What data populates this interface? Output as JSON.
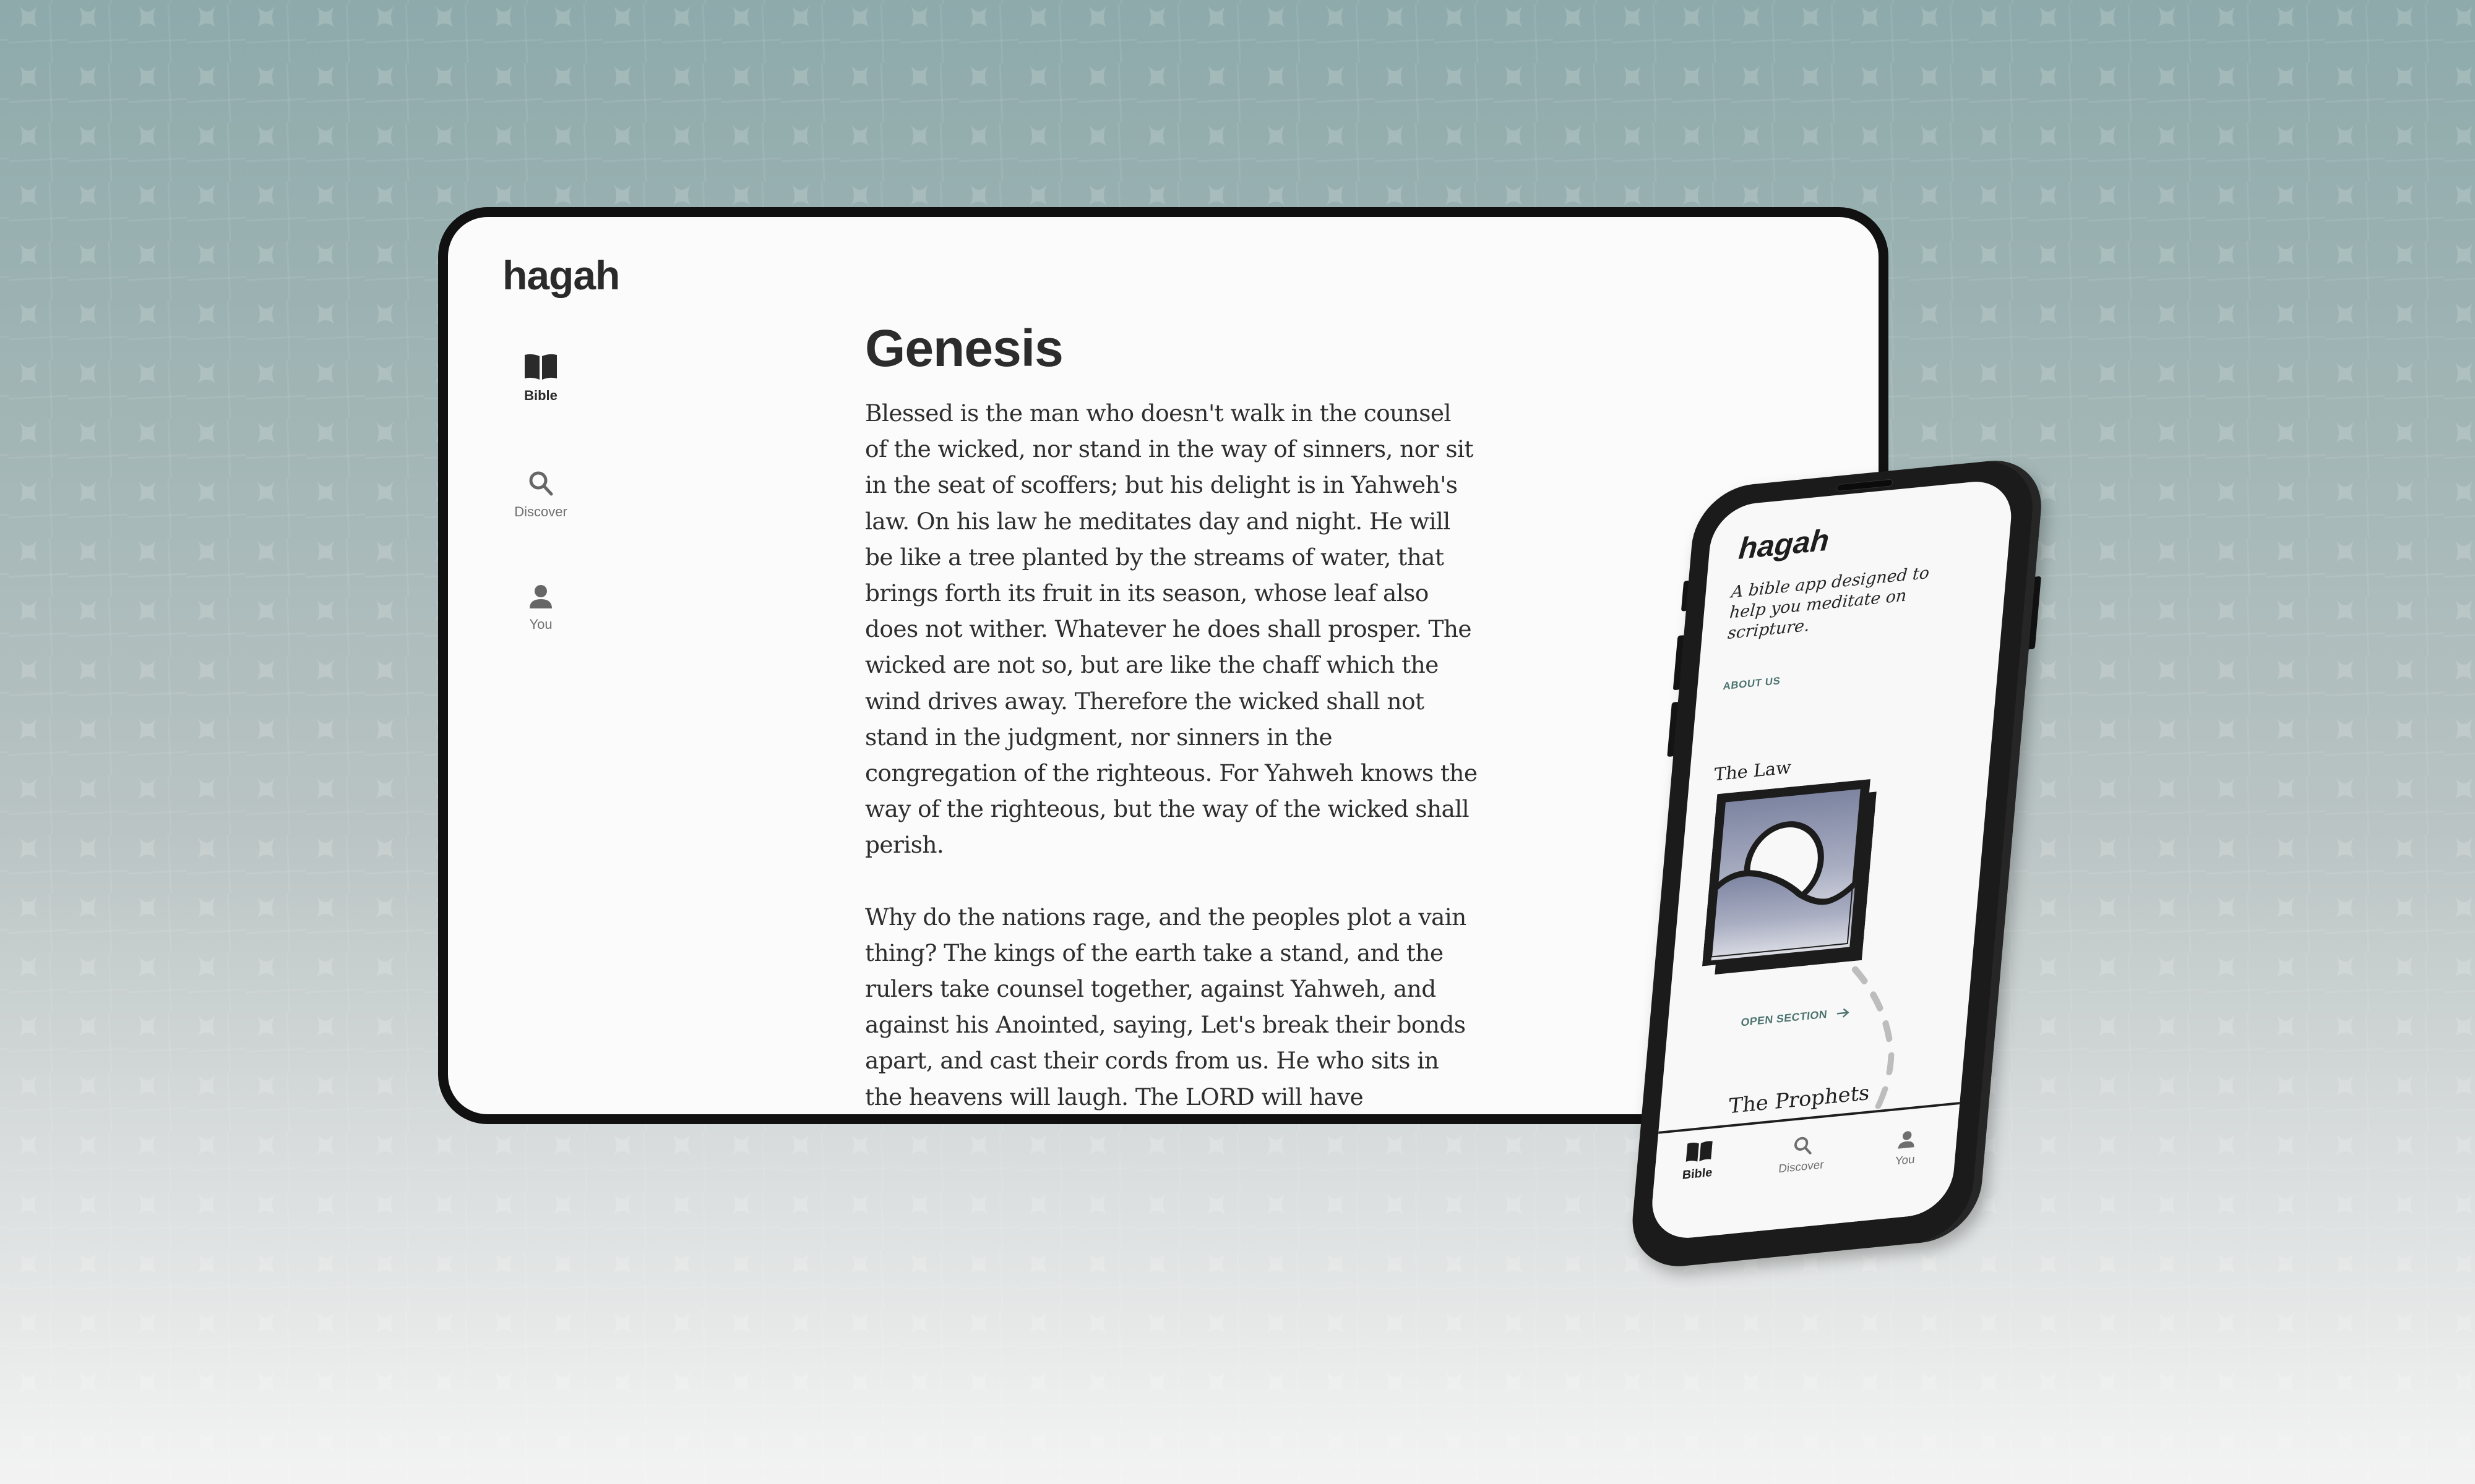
{
  "tablet": {
    "app_name": "hagah",
    "nav": [
      {
        "label": "Bible",
        "icon": "book-open-icon",
        "active": true
      },
      {
        "label": "Discover",
        "icon": "search-icon",
        "active": false
      },
      {
        "label": "You",
        "icon": "user-icon",
        "active": false
      }
    ],
    "page_title": "Genesis",
    "paragraphs": [
      "Blessed is the man who doesn't walk in the counsel of the wicked, nor stand in the way of sinners, nor sit in the seat of scoffers; but his delight is in Yahweh's law. On his law he meditates day and night. He will be like a tree planted by the streams of water, that brings forth its fruit in its season, whose leaf also does not wither. Whatever he does shall prosper. The wicked are not so, but are like the chaff which the wind drives away. Therefore the wicked shall not stand in the judgment, nor sinners in the congregation of the righteous. For Yahweh knows the way of the righteous, but the way of the wicked shall perish.",
      "Why do the nations rage, and the peoples plot a vain thing? The kings of the earth take a stand, and the rulers take counsel together, against Yahweh, and against his Anointed, saying, Let's break their bonds apart, and cast their cords from us. He who sits in the heavens will laugh. The LORD will have"
    ]
  },
  "phone": {
    "app_name": "hagah",
    "tagline": "A bible app designed to help you meditate on scripture.",
    "about_link": "ABOUT US",
    "sections": [
      {
        "title": "The Law",
        "cta": "OPEN SECTION",
        "cta_icon": "arrow-right-icon",
        "illustration": "sun-over-hill-icon"
      },
      {
        "title": "The Prophets"
      }
    ],
    "tabs": [
      {
        "label": "Bible",
        "icon": "book-open-icon",
        "active": true
      },
      {
        "label": "Discover",
        "icon": "search-icon",
        "active": false
      },
      {
        "label": "You",
        "icon": "user-icon",
        "active": false
      }
    ]
  },
  "colors": {
    "accent_teal": "#4d7471",
    "text_dark": "#2c2c2c",
    "text_muted": "#6f6f6f",
    "device_frame": "#111111",
    "card_gradient_top": "#7d84a1",
    "card_gradient_bottom": "#f1f1f3"
  }
}
